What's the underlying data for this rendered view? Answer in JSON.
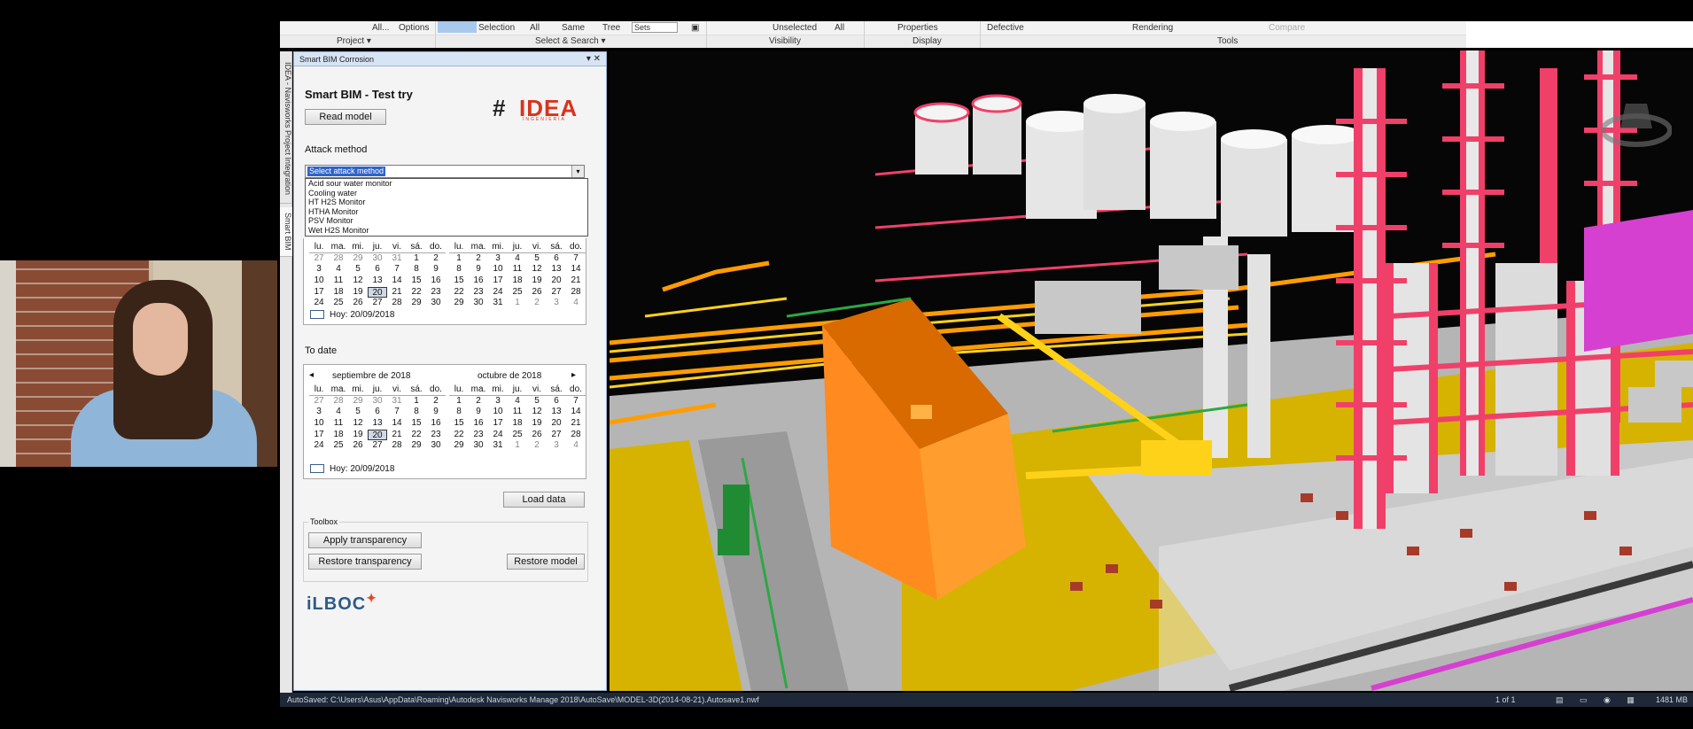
{
  "ribbon": {
    "row1": [
      {
        "id": "all",
        "label": "All..."
      },
      {
        "id": "options",
        "label": "Options"
      },
      {
        "id": "selection",
        "label": "Selection"
      },
      {
        "id": "all2",
        "label": "All"
      },
      {
        "id": "same",
        "label": "Same"
      },
      {
        "id": "tree",
        "label": "Tree"
      },
      {
        "id": "unselected",
        "label": "Unselected"
      },
      {
        "id": "all3",
        "label": "All"
      },
      {
        "id": "properties",
        "label": "Properties"
      },
      {
        "id": "defective",
        "label": "Defective"
      },
      {
        "id": "rendering",
        "label": "Rendering"
      },
      {
        "id": "compare",
        "label": "Compare"
      }
    ],
    "combo_value": "Sets",
    "groups": [
      "Project ▾",
      "Select & Search ▾",
      "Visibility",
      "Display",
      "Tools"
    ]
  },
  "side_tabs": [
    "IDEA - Navisworks Project Integration",
    "Smart BIM"
  ],
  "panel": {
    "window_title": "Smart BIM Corrosion",
    "window_controls": "▾ ✕",
    "heading": "Smart BIM - Test try",
    "read_model": "Read model",
    "logo_hash": "#",
    "logo_word": "IDEA",
    "logo_sub": "INGENIERÍA",
    "attack_method_label": "Attack method",
    "attack_select_value": "Select attack method",
    "attack_arrow": "▾",
    "attack_options": [
      "Acid sour water monitor",
      "Cooling water",
      "HT H2S Monitor",
      "HTHA Monitor",
      "PSV Monitor",
      "Wet H2S Monitor"
    ],
    "to_date_label": "To date",
    "load_data": "Load data",
    "toolbox_label": "Toolbox",
    "apply_transparency": "Apply transparency",
    "restore_transparency": "Restore transparency",
    "restore_model": "Restore model",
    "ilboc": "iLBOC"
  },
  "calendar_from": {
    "weekdays": [
      "lu.",
      "ma.",
      "mi.",
      "ju.",
      "vi.",
      "sá.",
      "do."
    ],
    "sept": [
      [
        "27",
        "28",
        "29",
        "30",
        "31",
        "1",
        "2"
      ],
      [
        "3",
        "4",
        "5",
        "6",
        "7",
        "8",
        "9"
      ],
      [
        "10",
        "11",
        "12",
        "13",
        "14",
        "15",
        "16"
      ],
      [
        "17",
        "18",
        "19",
        "20",
        "21",
        "22",
        "23"
      ],
      [
        "24",
        "25",
        "26",
        "27",
        "28",
        "29",
        "30"
      ]
    ],
    "oct": [
      [
        "1",
        "2",
        "3",
        "4",
        "5",
        "6",
        "7"
      ],
      [
        "8",
        "9",
        "10",
        "11",
        "12",
        "13",
        "14"
      ],
      [
        "15",
        "16",
        "17",
        "18",
        "19",
        "20",
        "21"
      ],
      [
        "22",
        "23",
        "24",
        "25",
        "26",
        "27",
        "28"
      ],
      [
        "29",
        "30",
        "31",
        "1",
        "2",
        "3",
        "4"
      ]
    ],
    "today": "Hoy: 20/09/2018"
  },
  "calendar_to": {
    "nav_prev": "◂",
    "nav_next": "▸",
    "month_left": "septiembre de 2018",
    "month_right": "octubre de 2018",
    "weekdays": [
      "lu.",
      "ma.",
      "mi.",
      "ju.",
      "vi.",
      "sá.",
      "do."
    ],
    "sept": [
      [
        "27",
        "28",
        "29",
        "30",
        "31",
        "1",
        "2"
      ],
      [
        "3",
        "4",
        "5",
        "6",
        "7",
        "8",
        "9"
      ],
      [
        "10",
        "11",
        "12",
        "13",
        "14",
        "15",
        "16"
      ],
      [
        "17",
        "18",
        "19",
        "20",
        "21",
        "22",
        "23"
      ],
      [
        "24",
        "25",
        "26",
        "27",
        "28",
        "29",
        "30"
      ]
    ],
    "oct": [
      [
        "1",
        "2",
        "3",
        "4",
        "5",
        "6",
        "7"
      ],
      [
        "8",
        "9",
        "10",
        "11",
        "12",
        "13",
        "14"
      ],
      [
        "15",
        "16",
        "17",
        "18",
        "19",
        "20",
        "21"
      ],
      [
        "22",
        "23",
        "24",
        "25",
        "26",
        "27",
        "28"
      ],
      [
        "29",
        "30",
        "31",
        "1",
        "2",
        "3",
        "4"
      ]
    ],
    "today": "Hoy: 20/09/2018"
  },
  "status": {
    "path": "AutoSaved: C:\\Users\\Asus\\AppData\\Roaming\\Autodesk Navisworks Manage 2018\\AutoSave\\MODEL-3D(2014-08-21).Autosave1.nwf",
    "page": "1 of 1",
    "memory": "1481 MB"
  },
  "colors": {
    "pipe_orange": "#ff9d00",
    "pipe_red": "#f0406a",
    "ground_yellow": "#d6b300",
    "building_orange": "#ff8a1f",
    "tank_white": "#e6e6e6",
    "magenta": "#d540d0"
  }
}
